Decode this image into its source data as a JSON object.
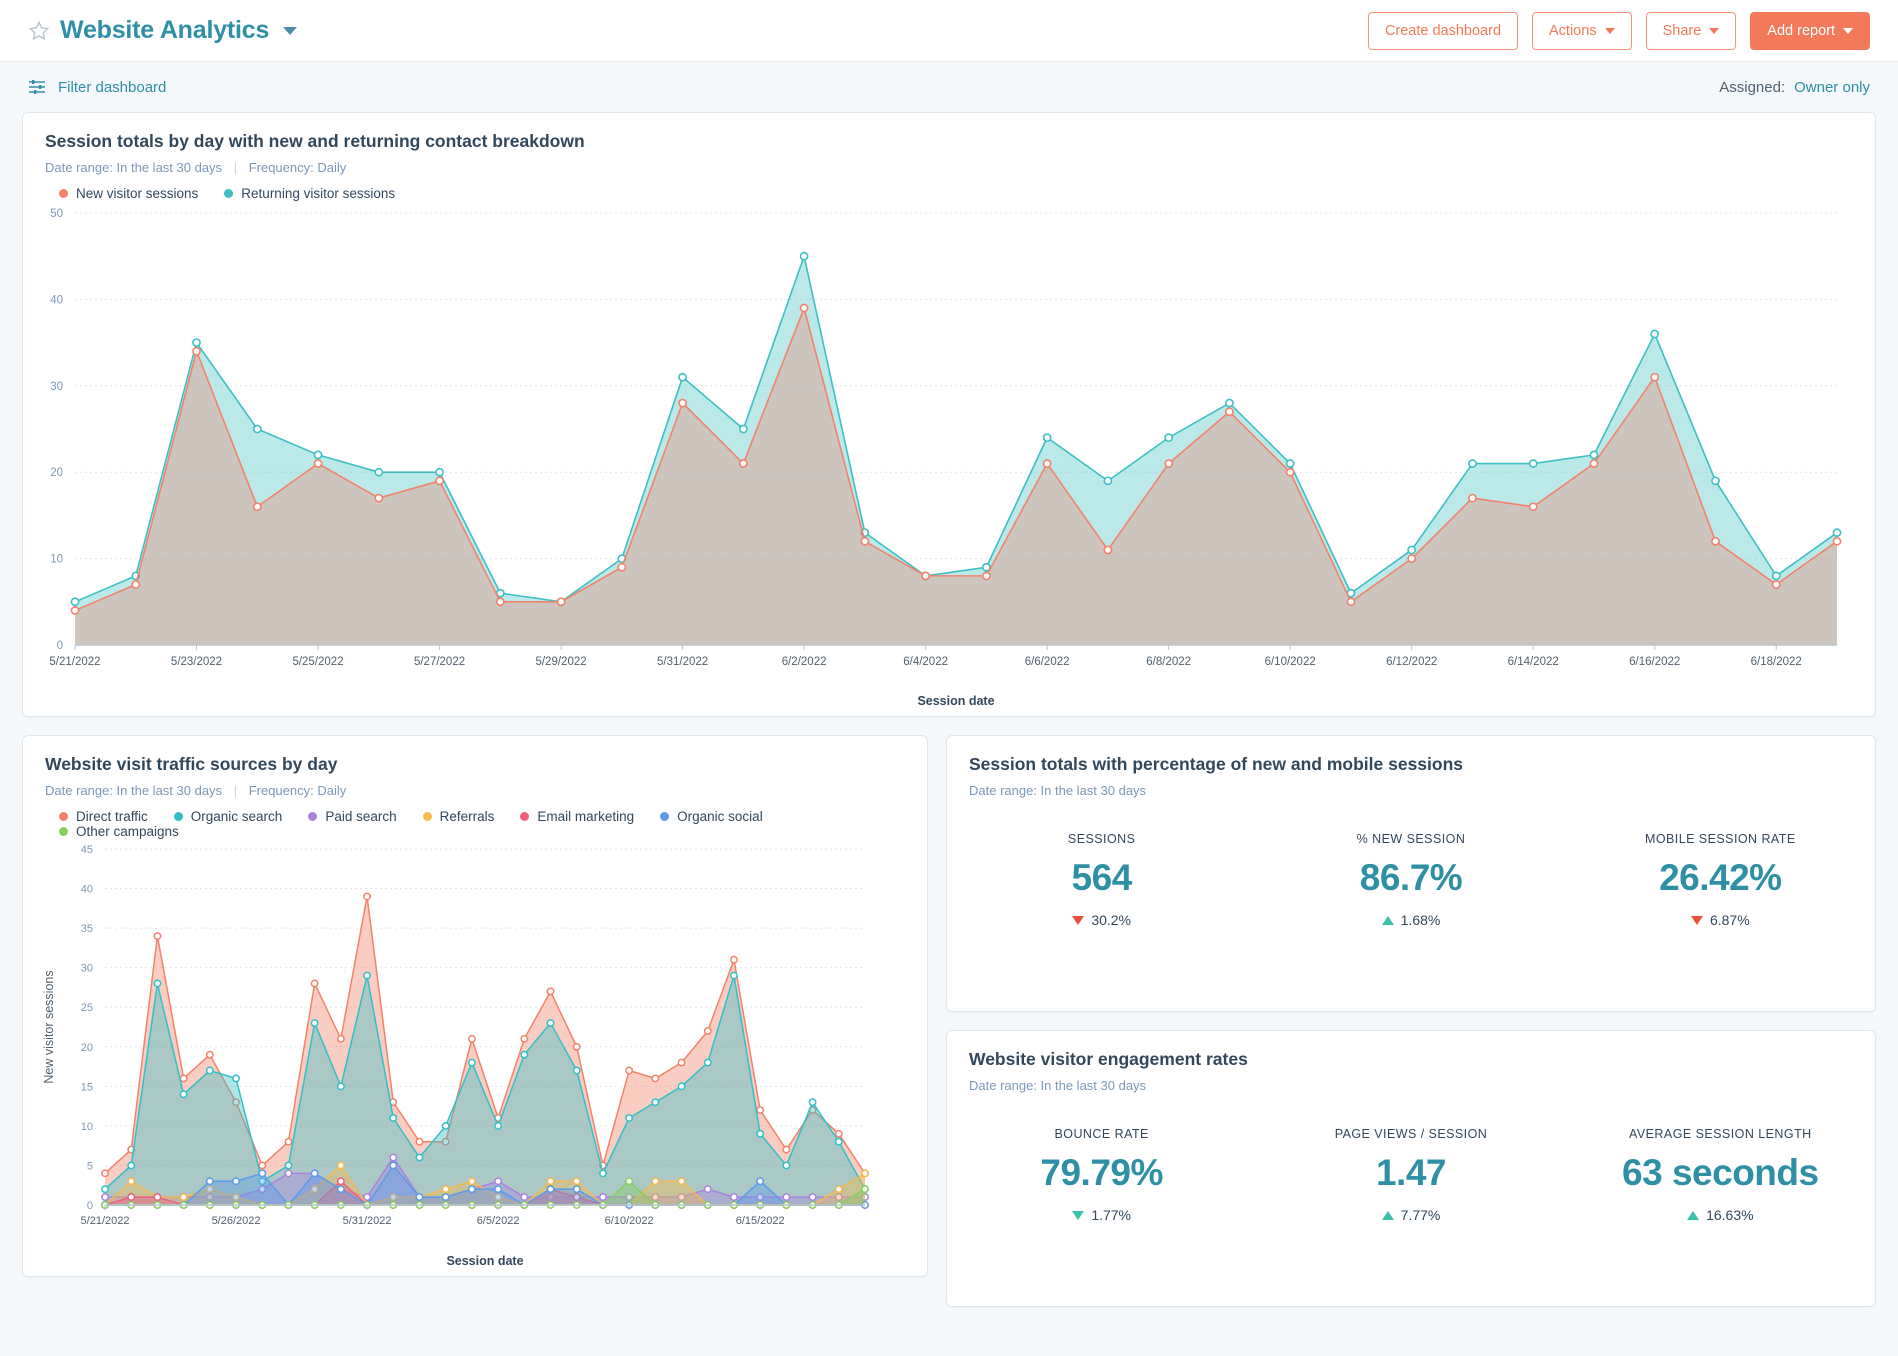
{
  "header": {
    "star_icon": "star-outline-icon",
    "title": "Website Analytics",
    "caret_icon": "chevron-down-icon",
    "buttons": [
      {
        "label": "Create dashboard",
        "style": "outline",
        "caret": false
      },
      {
        "label": "Actions",
        "style": "outline",
        "caret": true
      },
      {
        "label": "Share",
        "style": "outline",
        "caret": true
      },
      {
        "label": "Add report",
        "style": "solid",
        "caret": true
      }
    ]
  },
  "filterbar": {
    "icon": "sliders-icon",
    "filter_label": "Filter dashboard",
    "assigned_label": "Assigned:",
    "assigned_value": "Owner only"
  },
  "colors": {
    "brand_orange": "#f2795a",
    "link_teal": "#2e8fa5",
    "value_teal": "#2e8fa5",
    "series_new": "#f2826a",
    "series_returning": "#3dbfc4",
    "up_green": "#3dbfa8",
    "down_red": "#e8503a"
  },
  "cards": {
    "sessions_breakdown": {
      "title": "Session totals by day with new and returning contact breakdown",
      "date_range": "Date range: In the last 30 days",
      "frequency": "Frequency: Daily",
      "legend": [
        {
          "label": "New visitor sessions",
          "color": "#f2826a"
        },
        {
          "label": "Returning visitor sessions",
          "color": "#3dbfc4"
        }
      ]
    },
    "traffic_sources": {
      "title": "Website visit traffic sources by day",
      "date_range": "Date range: In the last 30 days",
      "frequency": "Frequency: Daily",
      "legend": [
        {
          "label": "Direct traffic",
          "color": "#f2826a"
        },
        {
          "label": "Organic search",
          "color": "#31c0c8"
        },
        {
          "label": "Paid search",
          "color": "#a982e0"
        },
        {
          "label": "Referrals",
          "color": "#f5b94d"
        },
        {
          "label": "Email marketing",
          "color": "#ee5f82"
        },
        {
          "label": "Organic social",
          "color": "#5a9bea"
        },
        {
          "label": "Other campaigns",
          "color": "#86cf5d"
        }
      ]
    },
    "session_totals_pct": {
      "title": "Session totals with percentage of new and mobile sessions",
      "date_range": "Date range: In the last 30 days",
      "kpis": [
        {
          "label": "SESSIONS",
          "value": "564",
          "delta": "30.2%",
          "direction": "down",
          "delta_color": "red"
        },
        {
          "label": "% NEW SESSION",
          "value": "86.7%",
          "delta": "1.68%",
          "direction": "up",
          "delta_color": "green"
        },
        {
          "label": "MOBILE SESSION RATE",
          "value": "26.42%",
          "delta": "6.87%",
          "direction": "down",
          "delta_color": "red"
        }
      ]
    },
    "engagement_rates": {
      "title": "Website visitor engagement rates",
      "date_range": "Date range: In the last 30 days",
      "kpis": [
        {
          "label": "BOUNCE RATE",
          "value": "79.79%",
          "delta": "1.77%",
          "direction": "down",
          "delta_color": "teal"
        },
        {
          "label": "PAGE VIEWS / SESSION",
          "value": "1.47",
          "delta": "7.77%",
          "direction": "up",
          "delta_color": "green"
        },
        {
          "label": "AVERAGE SESSION LENGTH",
          "value": "63 seconds",
          "delta": "16.63%",
          "direction": "up",
          "delta_color": "green"
        }
      ]
    }
  },
  "chart_data": [
    {
      "id": "sessions_breakdown",
      "type": "area",
      "title": "Session totals by day with new and returning contact breakdown",
      "xlabel": "Session date",
      "ylabel": "",
      "ylim": [
        0,
        50
      ],
      "yticks": [
        0,
        10,
        20,
        30,
        40,
        50
      ],
      "grid": true,
      "legend_position": "top-left",
      "x": [
        "5/21/2022",
        "5/22/2022",
        "5/23/2022",
        "5/24/2022",
        "5/25/2022",
        "5/26/2022",
        "5/27/2022",
        "5/28/2022",
        "5/29/2022",
        "5/30/2022",
        "5/31/2022",
        "6/1/2022",
        "6/2/2022",
        "6/3/2022",
        "6/4/2022",
        "6/5/2022",
        "6/6/2022",
        "6/7/2022",
        "6/8/2022",
        "6/9/2022",
        "6/10/2022",
        "6/11/2022",
        "6/12/2022",
        "6/13/2022",
        "6/14/2022",
        "6/15/2022",
        "6/16/2022",
        "6/17/2022",
        "6/18/2022",
        "6/19/2022"
      ],
      "xticks": [
        "5/21/2022",
        "5/23/2022",
        "5/25/2022",
        "5/27/2022",
        "5/29/2022",
        "5/31/2022",
        "6/2/2022",
        "6/4/2022",
        "6/6/2022",
        "6/8/2022",
        "6/10/2022",
        "6/12/2022",
        "6/14/2022",
        "6/16/2022",
        "6/18/2022"
      ],
      "series": [
        {
          "name": "Returning visitor sessions",
          "color": "#3dbfc4",
          "values": [
            5,
            8,
            35,
            25,
            22,
            20,
            20,
            6,
            5,
            10,
            31,
            25,
            45,
            13,
            8,
            9,
            24,
            19,
            24,
            28,
            21,
            6,
            11,
            21,
            21,
            22,
            36,
            19,
            8,
            13
          ]
        },
        {
          "name": "New visitor sessions",
          "color": "#f2826a",
          "values": [
            4,
            7,
            34,
            16,
            21,
            17,
            19,
            5,
            5,
            9,
            28,
            21,
            39,
            12,
            8,
            8,
            21,
            11,
            21,
            27,
            20,
            5,
            10,
            17,
            16,
            21,
            31,
            12,
            7,
            12
          ]
        }
      ]
    },
    {
      "id": "traffic_sources",
      "type": "area",
      "title": "Website visit traffic sources by day",
      "xlabel": "Session date",
      "ylabel": "New visitor sessions",
      "ylim": [
        0,
        45
      ],
      "yticks": [
        0,
        5,
        10,
        15,
        20,
        25,
        30,
        35,
        40,
        45
      ],
      "grid": true,
      "legend_position": "top-left",
      "x": [
        "5/21/2022",
        "5/22/2022",
        "5/23/2022",
        "5/24/2022",
        "5/25/2022",
        "5/26/2022",
        "5/27/2022",
        "5/28/2022",
        "5/29/2022",
        "5/30/2022",
        "5/31/2022",
        "6/1/2022",
        "6/2/2022",
        "6/3/2022",
        "6/4/2022",
        "6/5/2022",
        "6/6/2022",
        "6/7/2022",
        "6/8/2022",
        "6/9/2022",
        "6/10/2022",
        "6/11/2022",
        "6/12/2022",
        "6/13/2022",
        "6/14/2022",
        "6/15/2022",
        "6/16/2022",
        "6/17/2022",
        "6/18/2022",
        "6/19/2022"
      ],
      "xticks": [
        "5/21/2022",
        "5/26/2022",
        "5/31/2022",
        "6/5/2022",
        "6/10/2022",
        "6/15/2022"
      ],
      "series": [
        {
          "name": "Direct traffic",
          "color": "#f2826a",
          "values": [
            4,
            7,
            34,
            16,
            19,
            13,
            5,
            8,
            28,
            21,
            39,
            13,
            8,
            8,
            21,
            11,
            21,
            27,
            20,
            5,
            17,
            16,
            18,
            22,
            31,
            12,
            7,
            12,
            9,
            4
          ]
        },
        {
          "name": "Organic search",
          "color": "#31c0c8",
          "values": [
            2,
            5,
            28,
            14,
            17,
            16,
            3,
            5,
            23,
            15,
            29,
            11,
            6,
            10,
            18,
            10,
            19,
            23,
            17,
            4,
            11,
            13,
            15,
            18,
            29,
            9,
            5,
            13,
            8,
            2
          ]
        },
        {
          "name": "Paid search",
          "color": "#a982e0",
          "values": [
            1,
            1,
            1,
            1,
            1,
            1,
            2,
            4,
            4,
            2,
            1,
            6,
            1,
            1,
            2,
            3,
            1,
            1,
            1,
            1,
            1,
            1,
            1,
            2,
            1,
            1,
            1,
            1,
            1,
            1
          ]
        },
        {
          "name": "Referrals",
          "color": "#f5b94d",
          "values": [
            0,
            3,
            1,
            1,
            2,
            1,
            0,
            0,
            2,
            5,
            0,
            1,
            1,
            2,
            3,
            1,
            0,
            3,
            3,
            0,
            0,
            3,
            3,
            0,
            0,
            0,
            0,
            0,
            2,
            4
          ]
        },
        {
          "name": "Email marketing",
          "color": "#ee5f82",
          "values": [
            0,
            1,
            1,
            0,
            0,
            0,
            0,
            0,
            0,
            3,
            0,
            0,
            0,
            0,
            0,
            0,
            0,
            2,
            1,
            0,
            0,
            0,
            0,
            0,
            0,
            0,
            0,
            0,
            0,
            0
          ]
        },
        {
          "name": "Organic social",
          "color": "#5a9bea",
          "values": [
            0,
            0,
            0,
            0,
            3,
            3,
            4,
            0,
            4,
            2,
            0,
            5,
            1,
            1,
            2,
            2,
            0,
            2,
            2,
            0,
            0,
            0,
            0,
            0,
            0,
            3,
            0,
            0,
            0,
            0
          ]
        },
        {
          "name": "Other campaigns",
          "color": "#86cf5d",
          "values": [
            0,
            0,
            0,
            0,
            0,
            0,
            0,
            0,
            0,
            0,
            0,
            0,
            0,
            0,
            0,
            0,
            0,
            0,
            0,
            0,
            3,
            0,
            0,
            0,
            0,
            0,
            0,
            0,
            0,
            2
          ]
        }
      ]
    }
  ]
}
